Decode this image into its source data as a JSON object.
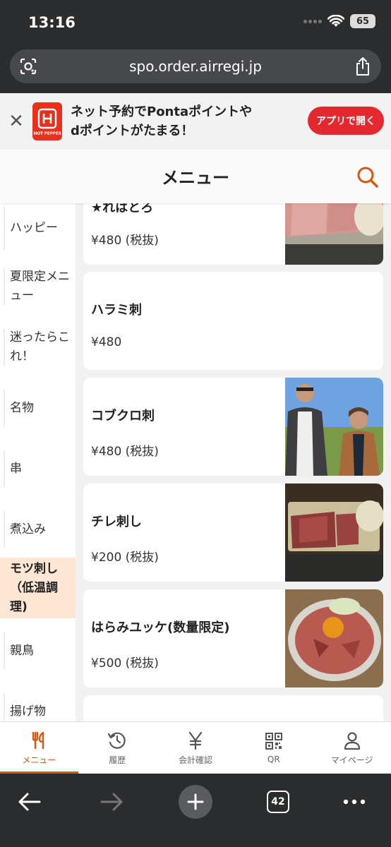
{
  "status_bar": {
    "time": "13:16",
    "battery": "65"
  },
  "browser": {
    "url": "spo.order.airregi.jp",
    "tab_count": "42"
  },
  "banner": {
    "close": "✕",
    "logo_caption": "HOT PEPPER",
    "line1": "ネット予約でPontaポイントや",
    "line2": "dポイントがたまる！",
    "button": "アプリで開く"
  },
  "header": {
    "title": "メニュー"
  },
  "categories": [
    {
      "label": "ハッピー"
    },
    {
      "label": "夏限定メニュー"
    },
    {
      "label": "迷ったらこれ！"
    },
    {
      "label": "名物"
    },
    {
      "label": "串"
    },
    {
      "label": "煮込み"
    },
    {
      "label": "モツ刺し（低温調理)",
      "active": true
    },
    {
      "label": "親鳥"
    },
    {
      "label": "揚げ物"
    }
  ],
  "items": [
    {
      "name": "★れはとろ",
      "price": "¥480 (税抜)",
      "image": "sliced-liver-photo"
    },
    {
      "name": "ハラミ刺",
      "price": "¥480",
      "image": ""
    },
    {
      "name": "コブクロ刺",
      "price": "¥480 (税抜)",
      "image": "two-men-photo"
    },
    {
      "name": "チレ刺し",
      "price": "¥200 (税抜)",
      "image": "sliced-meat-photo"
    },
    {
      "name": "はらみユッケ(数量限定)",
      "price": "¥500 (税抜)",
      "image": "yukhoe-photo"
    }
  ],
  "tabs": [
    {
      "label": "メニュー",
      "icon": "fork-knife-icon",
      "active": true
    },
    {
      "label": "履歴",
      "icon": "history-icon"
    },
    {
      "label": "会計確認",
      "icon": "yen-icon"
    },
    {
      "label": "QR",
      "icon": "qr-icon"
    },
    {
      "label": "マイページ",
      "icon": "person-icon"
    }
  ],
  "colors": {
    "accent": "#d9560f",
    "banner_button": "#e4282f",
    "active_category": "#fde6d3"
  }
}
